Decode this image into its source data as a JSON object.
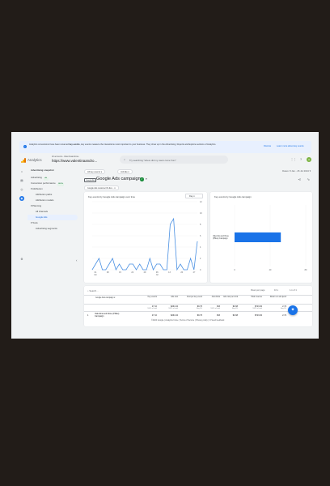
{
  "colors": {
    "accent": "#1a73e8",
    "line": "#4a90e2",
    "bar": "#1a73e8",
    "page": "#f1f3f4",
    "backdrop": "#221c18"
  },
  "banner": {
    "message_part1": "Analytics conversions have been renamed ",
    "message_bold": "key events",
    "message_part2": ", key events measure the interactions most important to your business. They show up in the Advertising, Reports and Explore sections of Analytics.",
    "dismiss": "Dismiss",
    "learn_more": "Learn more about key events"
  },
  "topbar": {
    "app_title": "Analytics",
    "account_path": "All accounts › Valentinaandrose",
    "account_name": "https://www.valentinaandro...",
    "search_placeholder": "Try searching \"where did my users come from\"",
    "icons": [
      "apps-icon",
      "help-icon",
      "avatar"
    ]
  },
  "sidebar": {
    "items": [
      {
        "label": "Advertising snapshot",
        "type": "hd"
      },
      {
        "label": "Advertising",
        "type": "item",
        "badge": "Ad"
      },
      {
        "label": "Conversion performance",
        "type": "item",
        "badge": "BETA"
      },
      {
        "label": "▾ Attribution",
        "type": "item"
      },
      {
        "label": "Attribution paths",
        "type": "sub"
      },
      {
        "label": "Attribution models",
        "type": "sub"
      },
      {
        "label": "▾ Planning",
        "type": "item"
      },
      {
        "label": "All channels",
        "type": "sub"
      },
      {
        "label": "Google Ads",
        "type": "sub",
        "active": true
      },
      {
        "label": "▾ Tools",
        "type": "item"
      },
      {
        "label": "Advertising segments",
        "type": "sub"
      }
    ]
  },
  "main": {
    "filter_all_users": "All key events ▾",
    "filter_job": "Job Ele ▾",
    "date_range": "Dates: 8 Jan - 26 Jul 2024 ▾",
    "google_box": "Google Ads",
    "page_title": "Google Ads campaigns",
    "compare_chip": "Google Ads customer ID &co... ▾",
    "line_card_title": "Key events by Google Ads campaign over time",
    "day_select": "Day ▾",
    "bar_card_title": "Key events by Google Ads campaign"
  },
  "chart_data": [
    {
      "type": "line",
      "title": "Key events by Google Ads campaign over time",
      "ylim": [
        0,
        12
      ],
      "y_ticks": [
        "0",
        "2",
        "4",
        "6",
        "8",
        "10",
        "12"
      ],
      "x_ticks": [
        "01\nJun",
        "08",
        "15",
        "22",
        "29",
        "06\nJul",
        "13",
        "20",
        "27"
      ],
      "series": [
        {
          "values": [
            0,
            1,
            2,
            0,
            0,
            1,
            2,
            0,
            1,
            0,
            0,
            1,
            1,
            0,
            1,
            0,
            0,
            2,
            0,
            1,
            1,
            0,
            0,
            8,
            9,
            0,
            1,
            0,
            0,
            2,
            0,
            5
          ]
        }
      ],
      "grid": true
    },
    {
      "type": "bar",
      "title": "Key events by Google Ads campaign",
      "categories": [
        "Valentina and Rose (PMax) Campaign"
      ],
      "values": [
        52
      ],
      "xlim": [
        0,
        80
      ],
      "x_ticks": [
        "0",
        "40",
        "80"
      ],
      "orientation": "horizontal"
    }
  ],
  "table": {
    "search_placeholder": "Search...",
    "rows_per_page_label": "Rows per page",
    "rows_per_page": "10 ▾",
    "pagination": "1-1 of 1",
    "dim_header": "Google Ads campaign ▾",
    "headers": [
      "Key events",
      "Ads cost",
      "Cost per key event",
      "Ads clicks",
      "Ads cost per click",
      "Total revenue",
      "Return on ad spend"
    ],
    "totals": [
      "27.10",
      "$264.34",
      "$9.76",
      "393",
      "$0.68",
      "$723.84",
      "2.74"
    ],
    "totals_sub": [
      "100% of total",
      "100% of total",
      "Avg 0%",
      "100% of total",
      "Avg 0%",
      "100% of total",
      "Avg 0%"
    ],
    "row_index": "1",
    "row_label": "Valentina and Rose (PMax) Campaign",
    "row_values": [
      "27.10",
      "$264.34",
      "$9.76",
      "393",
      "$0.68",
      "$723.84",
      "2.74"
    ]
  },
  "footer": "©2024 Google | Analytics home | Terms of Service | Privacy policy | ⊡ Send feedback"
}
